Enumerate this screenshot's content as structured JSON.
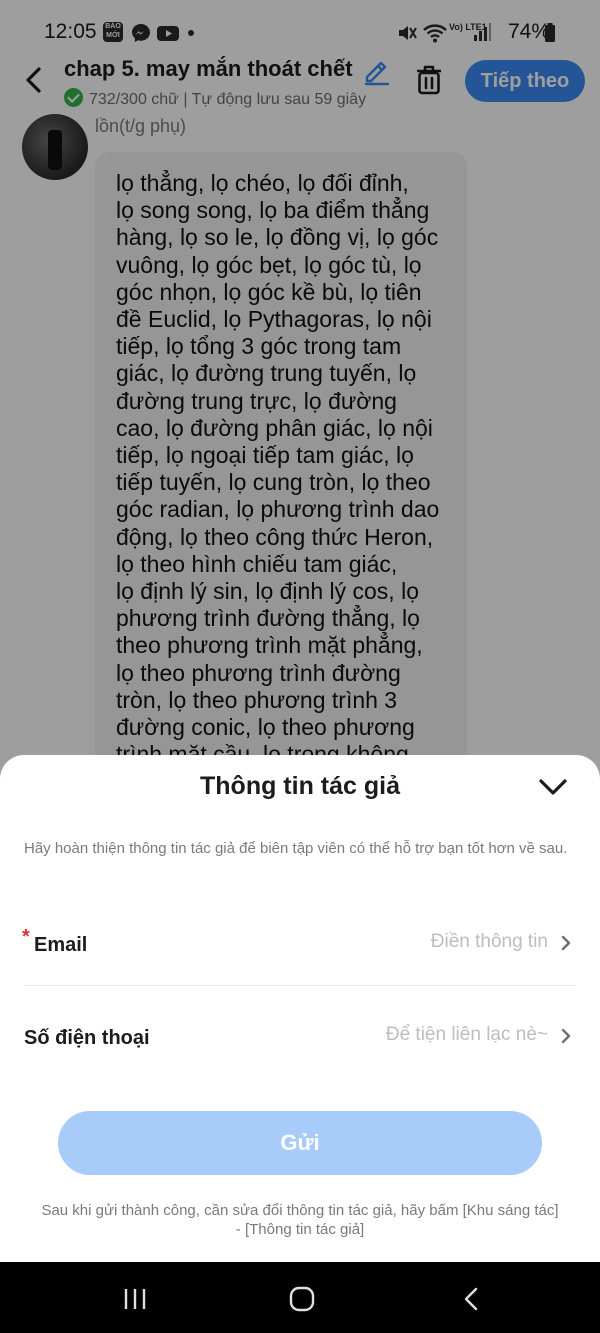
{
  "status_bar": {
    "time": "12:05",
    "notification_icons": [
      "BÁO MỚI",
      "messenger-icon",
      "youtube-icon"
    ],
    "notif_bao_moi_line1": "BÁO",
    "notif_bao_moi_line2": "MỚI",
    "network_label": "Vo) LTE1",
    "battery": "74%"
  },
  "header": {
    "title": "chap 5. may mắn thoát chết",
    "subtitle": "732/300 chữ | Tự động lưu sau 59 giây",
    "next_button": "Tiếp theo"
  },
  "post": {
    "author": "lồn(t/g phụ)",
    "content": " lọ thẳng, lọ chéo, lọ đối đỉnh,\nlọ song song, lọ ba điểm thẳng\nhàng, lọ so le, lọ đồng vị, lọ góc\nvuông, lọ góc bẹt, lọ góc tù, lọ\ngóc nhọn, lọ góc kề bù, lọ tiên\nđề Euclid, lọ Pythagoras, lọ nội\ntiếp, lọ tổng 3 góc trong tam\ngiác, lọ đường trung tuyến, lọ\nđường trung trực, lọ đường\ncao, lọ đường phân giác, lọ nội\ntiếp, lọ ngoại tiếp tam giác, lọ\ntiếp tuyến, lọ cung tròn, lọ theo\ngóc radian, lọ phương trình dao\nđộng, lọ theo công thức Heron,\nlọ theo hình chiếu tam giác,\nlọ định lý sin, lọ định lý cos, lọ\nphương trình đường thẳng, lọ\ntheo phương trình mặt phẳng,\nlọ theo phương trình đường\ntròn, lọ theo phương trình 3\nđường conic, lọ theo phương\ntrình mặt cầu, lọ trong không"
  },
  "sheet": {
    "title": "Thông tin tác giả",
    "description": "Hãy hoàn thiện thông tin tác giả để biên tập viên có thể hỗ trợ bạn tốt hơn về sau.",
    "email_label": "Email",
    "email_required_mark": "*",
    "email_placeholder": "Điền thông tin",
    "phone_label": "Số điện thoại",
    "phone_placeholder": "Để tiện liên lạc nè~",
    "submit_label": "Gửi",
    "footer_note": "Sau khi gửi thành công, cần sửa đổi thông tin tác giả, hãy bấm [Khu sáng tác] - [Thông tin tác giả]"
  },
  "colors": {
    "accent": "#3a8bf4",
    "submit_disabled": "#a7ccf9",
    "success": "#37b24d",
    "required": "#e03131"
  }
}
